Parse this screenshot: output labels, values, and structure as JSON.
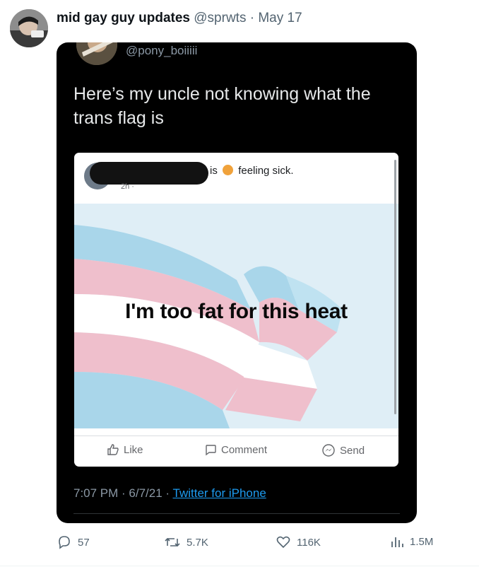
{
  "tweet": {
    "display_name": "mid gay guy updates",
    "handle": "@sprwts",
    "separator": "·",
    "date": "May 17"
  },
  "embedded": {
    "handle": "@pony_boiiiii",
    "text": "Here’s my uncle not knowing what the trans flag is",
    "timestamp": "7:07 PM · 6/7/21 ·",
    "source": "Twitter for iPhone"
  },
  "fb_post": {
    "status_is": "is",
    "status_feeling": "feeling sick.",
    "time": "2h ·",
    "post_text": "I'm too fat for this heat",
    "like_label": "Like",
    "comment_label": "Comment",
    "send_label": "Send"
  },
  "actions": {
    "replies": "57",
    "retweets": "5.7K",
    "likes": "116K",
    "views": "1.5M"
  },
  "colors": {
    "flag_blue": "#a9d6ea",
    "flag_pink": "#efbfcc",
    "flag_white": "#ffffff",
    "link_blue": "#1d9bf0",
    "muted": "#536471"
  }
}
